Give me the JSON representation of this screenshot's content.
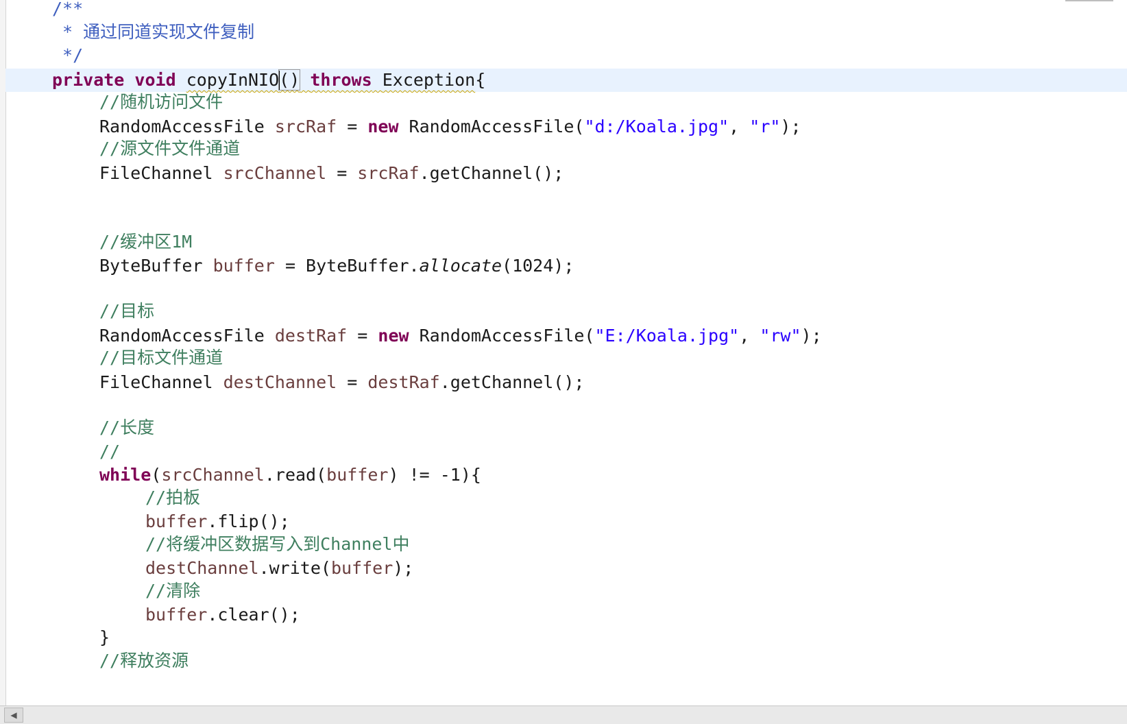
{
  "code_lines": [
    {
      "tokens": [
        {
          "t": "/**",
          "c": "jd"
        }
      ]
    },
    {
      "tokens": [
        {
          "t": " * ",
          "c": "jd"
        },
        {
          "t": "通过同道实现文件复制",
          "c": "jd"
        }
      ]
    },
    {
      "tokens": [
        {
          "t": " */",
          "c": "jd"
        }
      ]
    },
    {
      "tokens": [
        {
          "t": "private",
          "c": "kw"
        },
        {
          "t": " "
        },
        {
          "t": "void",
          "c": "kw"
        },
        {
          "t": " "
        },
        {
          "t": "copyInNIO",
          "c": "squiggle"
        },
        {
          "t": "caret"
        },
        {
          "t": "()",
          "c": "bracket-box squiggle"
        },
        {
          "t": " ",
          "c": "squiggle"
        },
        {
          "t": "throws",
          "c": "kw squiggle"
        },
        {
          "t": " ",
          "c": "squiggle"
        },
        {
          "t": "Exception",
          "c": "squiggle"
        },
        {
          "t": "{"
        }
      ]
    },
    {
      "tokens": [
        {
          "t": "//随机访问文件",
          "c": "cm"
        }
      ]
    },
    {
      "tokens": [
        {
          "t": "RandomAccessFile "
        },
        {
          "t": "srcRaf",
          "c": "var"
        },
        {
          "t": " = "
        },
        {
          "t": "new",
          "c": "kw"
        },
        {
          "t": " RandomAccessFile("
        },
        {
          "t": "\"d:/Koala.jpg\"",
          "c": "str"
        },
        {
          "t": ", "
        },
        {
          "t": "\"r\"",
          "c": "str"
        },
        {
          "t": ");"
        }
      ]
    },
    {
      "tokens": [
        {
          "t": "//源文件文件通道",
          "c": "cm"
        }
      ]
    },
    {
      "tokens": [
        {
          "t": "FileChannel "
        },
        {
          "t": "srcChannel",
          "c": "var"
        },
        {
          "t": " = "
        },
        {
          "t": "srcRaf",
          "c": "var"
        },
        {
          "t": ".getChannel();"
        }
      ]
    },
    {
      "tokens": []
    },
    {
      "tokens": []
    },
    {
      "tokens": [
        {
          "t": "//缓冲区1M",
          "c": "cm"
        }
      ]
    },
    {
      "tokens": [
        {
          "t": "ByteBuffer "
        },
        {
          "t": "buffer",
          "c": "var"
        },
        {
          "t": " = ByteBuffer."
        },
        {
          "t": "allocate",
          "c": "it"
        },
        {
          "t": "(1024);"
        }
      ]
    },
    {
      "tokens": []
    },
    {
      "tokens": [
        {
          "t": "//目标",
          "c": "cm"
        }
      ]
    },
    {
      "tokens": [
        {
          "t": "RandomAccessFile "
        },
        {
          "t": "destRaf",
          "c": "var"
        },
        {
          "t": " = "
        },
        {
          "t": "new",
          "c": "kw"
        },
        {
          "t": " RandomAccessFile("
        },
        {
          "t": "\"E:/Koala.jpg\"",
          "c": "str"
        },
        {
          "t": ", "
        },
        {
          "t": "\"rw\"",
          "c": "str"
        },
        {
          "t": ");"
        }
      ]
    },
    {
      "tokens": [
        {
          "t": "//目标文件通道",
          "c": "cm"
        }
      ]
    },
    {
      "tokens": [
        {
          "t": "FileChannel "
        },
        {
          "t": "destChannel",
          "c": "var"
        },
        {
          "t": " = "
        },
        {
          "t": "destRaf",
          "c": "var"
        },
        {
          "t": ".getChannel();"
        }
      ]
    },
    {
      "tokens": []
    },
    {
      "tokens": [
        {
          "t": "//长度",
          "c": "cm"
        }
      ]
    },
    {
      "tokens": [
        {
          "t": "//",
          "c": "cm"
        }
      ]
    },
    {
      "tokens": [
        {
          "t": "while",
          "c": "kw"
        },
        {
          "t": "("
        },
        {
          "t": "srcChannel",
          "c": "var"
        },
        {
          "t": ".read("
        },
        {
          "t": "buffer",
          "c": "var"
        },
        {
          "t": ") != -1){"
        }
      ]
    },
    {
      "tokens": [
        {
          "t": "//拍板",
          "c": "cm"
        }
      ]
    },
    {
      "tokens": [
        {
          "t": "buffer",
          "c": "var"
        },
        {
          "t": ".flip();"
        }
      ]
    },
    {
      "tokens": [
        {
          "t": "//将缓冲区数据写入到Channel中",
          "c": "cm"
        }
      ]
    },
    {
      "tokens": [
        {
          "t": "destChannel",
          "c": "var"
        },
        {
          "t": ".write("
        },
        {
          "t": "buffer",
          "c": "var"
        },
        {
          "t": ");"
        }
      ]
    },
    {
      "tokens": [
        {
          "t": "//清除",
          "c": "cm"
        }
      ]
    },
    {
      "tokens": [
        {
          "t": "buffer",
          "c": "var"
        },
        {
          "t": ".clear();"
        }
      ]
    },
    {
      "tokens": [
        {
          "t": "}"
        }
      ]
    },
    {
      "tokens": [
        {
          "t": "//释放资源",
          "c": "cm"
        }
      ]
    }
  ],
  "scrollbar": {
    "left_arrow": "◀"
  },
  "colors": {
    "keyword": "#7f0055",
    "comment": "#3f7f5f",
    "javadoc": "#3f5fbf",
    "string": "#2a00ff",
    "variable": "#6a3e3e",
    "current_line": "#e8f2fe"
  }
}
